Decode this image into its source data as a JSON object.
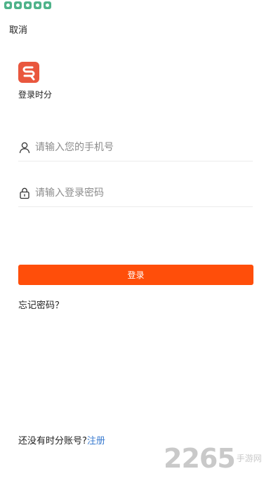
{
  "status_bar": {
    "icons": [
      "app-icon",
      "app-icon",
      "app-icon",
      "app-icon",
      "app-icon"
    ]
  },
  "header": {
    "cancel_label": "取消"
  },
  "app": {
    "name": "登录时分",
    "brand_color": "#e9573e"
  },
  "form": {
    "phone_placeholder": "请输入您的手机号",
    "password_placeholder": "请输入登录密码",
    "login_label": "登录",
    "login_color": "#ff4e0a",
    "forgot_label": "忘记密码？"
  },
  "footer": {
    "register_prompt": "还没有时分账号?",
    "register_link": "注册",
    "link_color": "#3b7cd0"
  },
  "watermark": {
    "number": "2265",
    "text": "手游网"
  }
}
